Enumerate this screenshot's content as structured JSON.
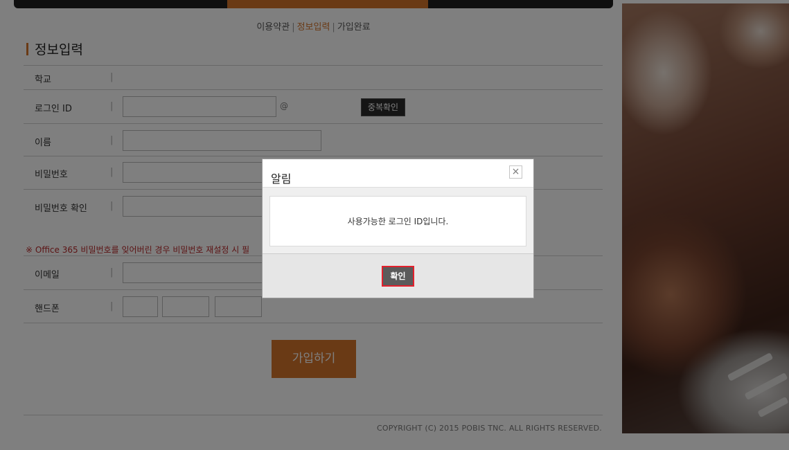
{
  "steps": [
    "이용약관",
    "정보입력",
    "가입완료"
  ],
  "section_title": "정보입력",
  "form": {
    "school_label": "학교",
    "login_label": "로그인 ID",
    "at_sign": "@",
    "dup_check_label": "중복확인",
    "name_label": "이름",
    "password_label": "비밀번호",
    "password_confirm_label": "비밀번호 확인",
    "note": "※ Office 365 비밀번호를 잊어버린 경우 비밀번호 재설정 시 필",
    "email_label": "이메일",
    "phone_label": "핸드폰",
    "pipe": "|"
  },
  "submit_label": "가입하기",
  "copyright": "COPYRIGHT (C) 2015 POBIS TNC. ALL RIGHTS RESERVED.",
  "modal": {
    "title": "알림",
    "close_glyph": "×",
    "message": "사용가능한 로그인 ID입니다.",
    "ok_label": "확인"
  },
  "colors": {
    "accent": "#d4742b",
    "note": "#b9282a",
    "ok_border": "#e3202c"
  }
}
